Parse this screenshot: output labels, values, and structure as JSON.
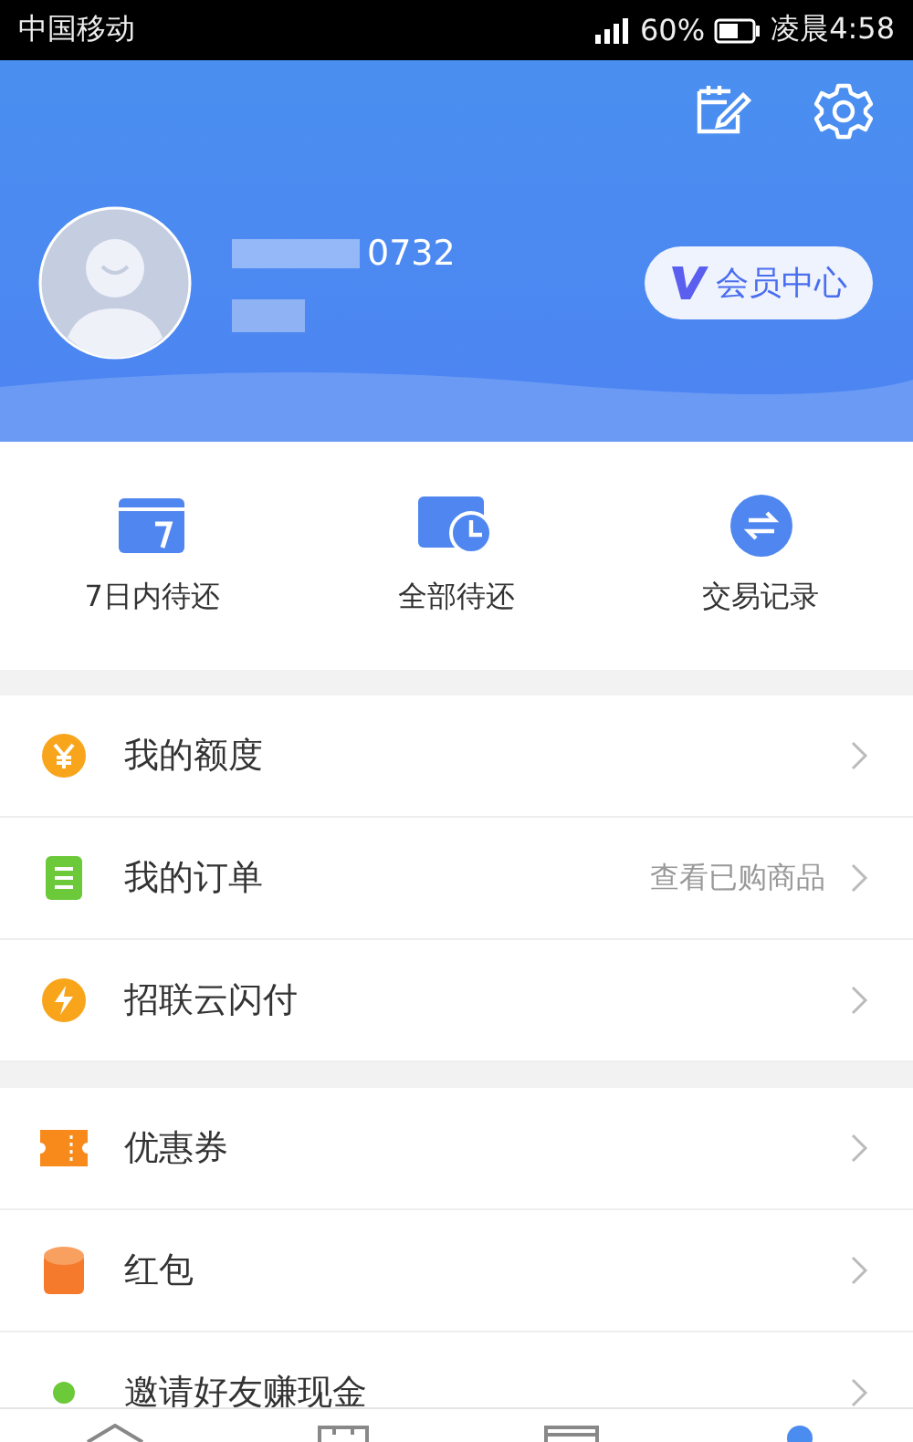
{
  "status_bar": {
    "carrier": "中国移动",
    "battery": "60%",
    "time": "凌晨4:58"
  },
  "profile": {
    "account": "0732",
    "member_button": "会员中心"
  },
  "shortcuts": [
    {
      "label": "7日内待还",
      "kind": "calendar"
    },
    {
      "label": "全部待还",
      "kind": "clock"
    },
    {
      "label": "交易记录",
      "kind": "exchange"
    }
  ],
  "menu_groups": [
    [
      {
        "label": "我的额度",
        "kind": "yen"
      },
      {
        "label": "我的订单",
        "kind": "list",
        "note": "查看已购商品"
      },
      {
        "label": "招联云闪付",
        "kind": "bolt"
      }
    ],
    [
      {
        "label": "优惠券",
        "kind": "coupon"
      },
      {
        "label": "红包",
        "kind": "packet"
      },
      {
        "label": "邀请好友赚现金",
        "kind": "dot"
      }
    ]
  ],
  "bottom_tabs": [
    {
      "kind": "home",
      "selected": false
    },
    {
      "kind": "shop",
      "selected": false
    },
    {
      "kind": "card",
      "selected": false
    },
    {
      "kind": "me",
      "selected": true
    }
  ]
}
